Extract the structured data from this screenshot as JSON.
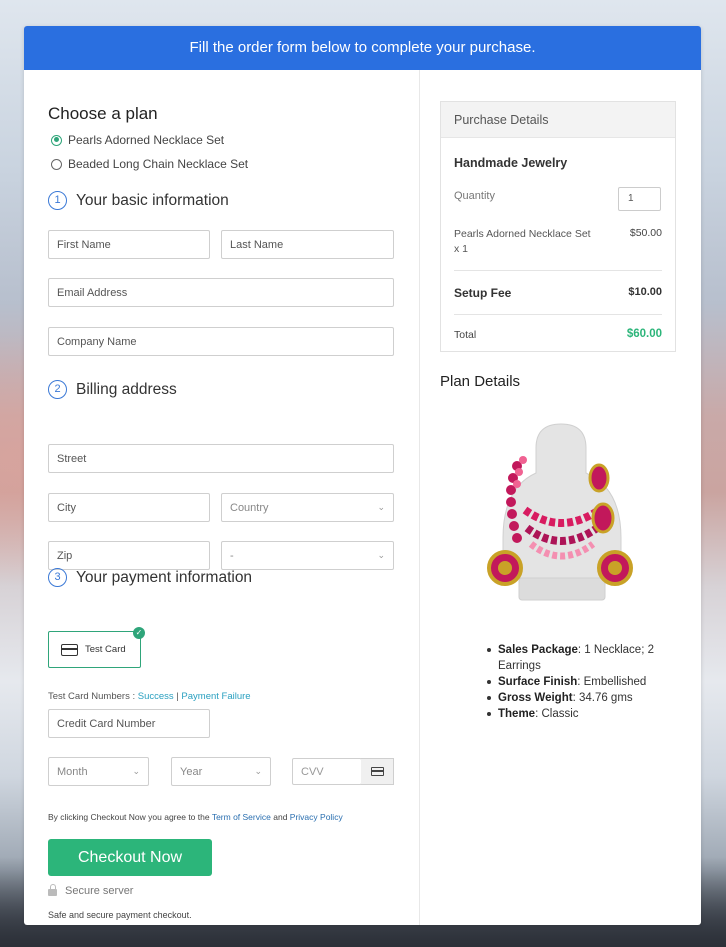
{
  "banner": "Fill the order form below to complete your purchase.",
  "plan": {
    "title": "Choose a plan",
    "options": [
      {
        "label": "Pearls Adorned Necklace Set",
        "selected": true
      },
      {
        "label": "Beaded Long Chain Necklace Set",
        "selected": false
      }
    ]
  },
  "sections": {
    "basic": {
      "num": "1",
      "title": "Your basic information"
    },
    "billing": {
      "num": "2",
      "title": "Billing address"
    },
    "payment": {
      "num": "3",
      "title": "Your payment information"
    }
  },
  "fields": {
    "first_name": "First Name",
    "last_name": "Last Name",
    "email": "Email Address",
    "company": "Company Name",
    "street": "Street",
    "city": "City",
    "country": "Country",
    "zip": "Zip",
    "state": "-",
    "card_number": "Credit Card Number",
    "month": "Month",
    "year": "Year",
    "cvv": "CVV"
  },
  "payment": {
    "method_label": "Test Card",
    "test_numbers_label": "Test Card Numbers :",
    "success_link": "Success",
    "separator": "|",
    "failure_link": "Payment Failure"
  },
  "terms": {
    "prefix": "By clicking Checkout Now you agree to the",
    "tos": "Term of Service",
    "and": "and",
    "privacy": "Privacy Policy"
  },
  "checkout_label": "Checkout Now",
  "secure_label": "Secure server",
  "safe_label": "Safe and secure payment checkout.",
  "purchase": {
    "title": "Purchase Details",
    "product": "Handmade Jewelry",
    "quantity_label": "Quantity",
    "quantity_value": "1",
    "item_name": "Pearls Adorned Necklace Set x 1",
    "item_price": "$50.00",
    "setup_label": "Setup Fee",
    "setup_price": "$10.00",
    "total_label": "Total",
    "total_price": "$60.00",
    "total_color": "#2cb57a"
  },
  "plan_details": {
    "title": "Plan Details",
    "specs": [
      {
        "key": "Sales Package",
        "value": ": 1 Necklace; 2 Earrings"
      },
      {
        "key": "Surface Finish",
        "value": ": Embellished"
      },
      {
        "key": "Gross Weight",
        "value": ": 34.76 gms"
      },
      {
        "key": "Theme",
        "value": ": Classic"
      }
    ]
  },
  "colors": {
    "banner": "#2a6fe0",
    "accent_green": "#2cb57a",
    "section_blue": "#3b79d6"
  }
}
